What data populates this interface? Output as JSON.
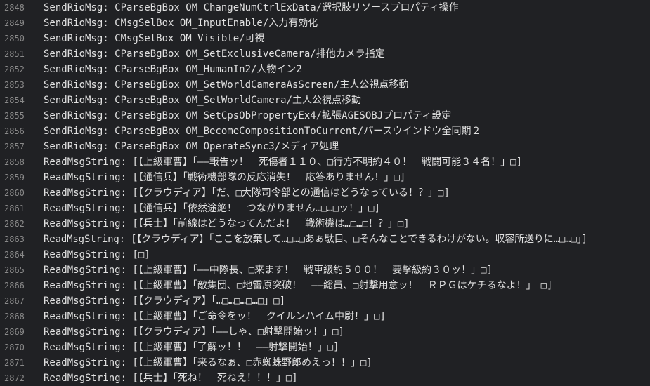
{
  "log": {
    "lines": [
      {
        "number": "2848",
        "text": "SendRioMsg: CParseBgBox OM_ChangeNumCtrlExData/選択肢リソースプロパティ操作"
      },
      {
        "number": "2849",
        "text": "SendRioMsg: CMsgSelBox OM_InputEnable/入力有効化"
      },
      {
        "number": "2850",
        "text": "SendRioMsg: CMsgSelBox OM_Visible/可視"
      },
      {
        "number": "2851",
        "text": "SendRioMsg: CParseBgBox OM_SetExclusiveCamera/排他カメラ指定"
      },
      {
        "number": "2852",
        "text": "SendRioMsg: CParseBgBox OM_HumanIn2/人物イン2"
      },
      {
        "number": "2853",
        "text": "SendRioMsg: CParseBgBox OM_SetWorldCameraAsScreen/主人公視点移動"
      },
      {
        "number": "2854",
        "text": "SendRioMsg: CParseBgBox OM_SetWorldCamera/主人公視点移動"
      },
      {
        "number": "2855",
        "text": "SendRioMsg: CParseBgBox OM_SetCpsObPropertyEx4/拡張AGESOBJプロパティ設定"
      },
      {
        "number": "2856",
        "text": "SendRioMsg: CParseBgBox OM_BecomeCompositionToCurrent/パースウインドウ全同期２"
      },
      {
        "number": "2857",
        "text": "SendRioMsg: CParseBgBox OM_OperateSync3/メディア処理"
      },
      {
        "number": "2858",
        "text": "ReadMsgString: [【上級軍曹】「――報告ッ！　死傷者１１０、□行方不明約４０！　戦闘可能３４名！」□]"
      },
      {
        "number": "2859",
        "text": "ReadMsgString: [【通信兵】「戦術機部隊の反応消失！　応答ありません！」□]"
      },
      {
        "number": "2860",
        "text": "ReadMsgString: [【クラウディア】「だ、□大隊司令部との通信はどうなっている！？」□]"
      },
      {
        "number": "2861",
        "text": "ReadMsgString: [【通信兵】「依然途絶！　つながりません…□…□ッ！」□]"
      },
      {
        "number": "2862",
        "text": "ReadMsgString: [【兵士】「前線はどうなってんだよ！　戦術機は…□…□！？」□]"
      },
      {
        "number": "2863",
        "text": "ReadMsgString: [【クラウディア】「ここを放棄して…□…□あぁ駄目、□そんなことできるわけがない。収容所送りに…□…□」]"
      },
      {
        "number": "2864",
        "text": "ReadMsgString: [□]"
      },
      {
        "number": "2865",
        "text": "ReadMsgString: [【上級軍曹】「――中隊長、□来ます！　戦車級約５００！　要撃級約３０ッ！」□]"
      },
      {
        "number": "2866",
        "text": "ReadMsgString: [【上級軍曹】「敵集団、□地雷原突破！　――総員、□射撃用意ッ！　ＲＰＧはケチるなよ！」　□]"
      },
      {
        "number": "2867",
        "text": "ReadMsgString: [【クラウディア】「…□…□…□…□」□]"
      },
      {
        "number": "2868",
        "text": "ReadMsgString: [【上級軍曹】「ご命令をッ！　クイルンハイム中尉！」□]"
      },
      {
        "number": "2869",
        "text": "ReadMsgString: [【クラウディア】「――しゃ、□射撃開始ッ！」□]"
      },
      {
        "number": "2870",
        "text": "ReadMsgString: [【上級軍曹】「了解ッ！！　――射撃開始！」□]"
      },
      {
        "number": "2871",
        "text": "ReadMsgString: [【上級軍曹】「来るなぁ、□赤蜘蛛野郎めえっ！！」□]"
      },
      {
        "number": "2872",
        "text": "ReadMsgString: [【兵士】「死ね！　死ねえ！！！」□]"
      }
    ]
  }
}
